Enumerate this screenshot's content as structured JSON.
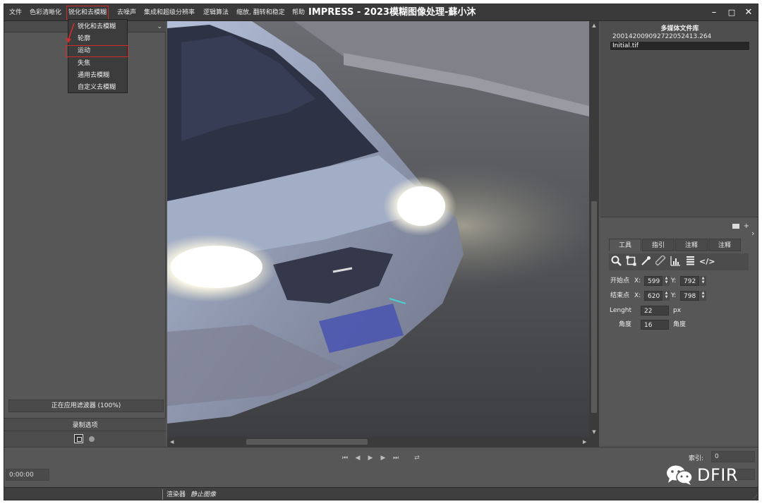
{
  "menu": {
    "file": "文件",
    "color_sharpen": "色彩清晰化",
    "sharpen_deblur": "锐化和去模糊",
    "denoise": "去噪声",
    "integrate_superres": "集成和超级分辨率",
    "logic": "逻辑算法",
    "zoom_flip": "缩放, 翻转和稳定",
    "help": "帮助"
  },
  "app_title": "IMPRESS - 2023模糊图像处理-蘇小沐",
  "window_controls": {
    "minimize": "–",
    "maximize": "□",
    "close": "✕"
  },
  "dropdown": {
    "items": [
      "锐化和去模糊",
      "轮廓",
      "运动",
      "失焦",
      "通用去模糊",
      "自定义去模糊"
    ],
    "highlighted_index": 2
  },
  "left_panel": {
    "chevron": "⌄",
    "filter_status": "正在应用滤波器 (100%)",
    "record_options": "录制选项"
  },
  "library": {
    "title": "多媒体文件库",
    "files": [
      "20014200909272205241​3.264",
      "Initial.tif"
    ],
    "selected_index": 1,
    "add": "+"
  },
  "tools_panel": {
    "tabs": [
      "工具",
      "指引",
      "注释",
      "注释"
    ],
    "icons": [
      "zoom-icon",
      "crop-icon",
      "eyedropper-icon",
      "ruler-icon",
      "histogram-icon",
      "lines-icon",
      "code-icon"
    ],
    "start_label": "开始点",
    "end_label": "结束点",
    "x_label": "X:",
    "y_label": "Y:",
    "start_x": "599",
    "start_y": "792",
    "end_x": "620",
    "end_y": "798",
    "length_label": "Lenght",
    "length_value": "22",
    "length_unit": "px",
    "angle_label": "角度",
    "angle_value": "16",
    "angle_unit": "角度"
  },
  "bottom": {
    "timecode": "0:00:00",
    "index_label": "索引:",
    "index_value": "0"
  },
  "watermark": {
    "text": "DFIR"
  },
  "status": {
    "renderer": "渲染器",
    "mode": "静止图像"
  },
  "colors": {
    "highlight_red": "#d42a2a",
    "panel_bg": "#575757",
    "menubar_bg": "#3a3a3a"
  }
}
